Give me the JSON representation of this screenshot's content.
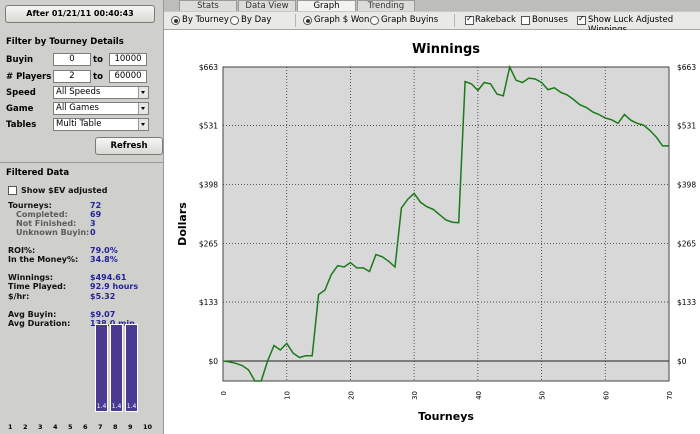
{
  "filter": {
    "date_button": "After 01/21/11 00:40:43",
    "title": "Filter by Tourney Details",
    "buyin_label": "Buyin",
    "buyin_min": "0",
    "buyin_max": "10000",
    "players_label": "# Players",
    "players_min": "2",
    "players_max": "60000",
    "to_label": "to",
    "speed_label": "Speed",
    "speed_value": "All Speeds",
    "game_label": "Game",
    "game_value": "All Games",
    "tables_label": "Tables",
    "tables_value": "Multi Table",
    "refresh_label": "Refresh"
  },
  "filtered": {
    "title": "Filtered Data",
    "sev_label": "Show $EV adjusted",
    "tourneys_label": "Tourneys:",
    "tourneys": "72",
    "completed_label": "Completed:",
    "completed": "69",
    "notfinished_label": "Not Finished:",
    "notfinished": "3",
    "unknown_label": "Unknown Buyin:",
    "unknown": "0",
    "roi_label": "ROI%:",
    "roi": "79.0%",
    "itm_label": "In the Money%:",
    "itm": "34.8%",
    "winnings_label": "Winnings:",
    "winnings": "$494.61",
    "time_label": "Time Played:",
    "time": "92.9  hours",
    "hr_label": "$/hr:",
    "hr": "$5.32",
    "avgbuyin_label": "Avg Buyin:",
    "avgbuyin": "$9.07",
    "avgdur_label": "Avg Duration:",
    "avgdur": "138.0  min"
  },
  "histogram": {
    "labels": [
      "1",
      "2",
      "3",
      "4",
      "5",
      "6",
      "7",
      "8",
      "9",
      "10"
    ],
    "values": [
      0,
      0,
      0,
      0,
      0,
      0,
      1.4,
      1.4,
      1.4,
      0
    ],
    "bar_color": "#4a3a92"
  },
  "tabs": [
    {
      "label": "Stats",
      "active": false
    },
    {
      "label": "Data View",
      "active": false
    },
    {
      "label": "Graph",
      "active": true
    },
    {
      "label": "Trending",
      "active": false
    }
  ],
  "options": {
    "by_tourney": "By Tourney",
    "by_day": "By Day",
    "graph_won": "Graph $ Won",
    "graph_buyins": "Graph Buyins",
    "rakeback": "Rakeback",
    "bonuses": "Bonuses",
    "luck": "Show Luck Adjusted Winnings"
  },
  "chart_data": {
    "type": "line",
    "title": "Winnings",
    "xlabel": "Tourneys",
    "ylabel": "Dollars",
    "xlim": [
      0,
      70
    ],
    "ylim": [
      -45,
      663
    ],
    "xticks": [
      0,
      10,
      20,
      30,
      40,
      50,
      60,
      70
    ],
    "yticks": [
      0,
      133,
      265,
      398,
      531,
      663
    ],
    "ytick_labels": [
      "$0",
      "$133",
      "$265",
      "$398",
      "$531",
      "$663"
    ],
    "grid": true,
    "line_color": "#1a7a1a",
    "series": [
      {
        "x": [
          0,
          1,
          2,
          3,
          4,
          5,
          6,
          7,
          8,
          9,
          10,
          11,
          12,
          13,
          14,
          15,
          16,
          17,
          18,
          19,
          20,
          21,
          22,
          23,
          24,
          25,
          26,
          27,
          28,
          29,
          30,
          31,
          32,
          33,
          34,
          35,
          36,
          37,
          38,
          39,
          40,
          41,
          42,
          43,
          44,
          45,
          46,
          47,
          48,
          49,
          50,
          51,
          52,
          53,
          54,
          55,
          56,
          57,
          58,
          59,
          60,
          61,
          62,
          63,
          64,
          65,
          66,
          67,
          68,
          69,
          70
        ],
        "y": [
          0,
          -2,
          -5,
          -10,
          -20,
          -45,
          -45,
          0,
          35,
          25,
          40,
          18,
          8,
          12,
          12,
          150,
          160,
          195,
          215,
          212,
          222,
          210,
          210,
          202,
          240,
          235,
          225,
          212,
          345,
          365,
          378,
          358,
          348,
          342,
          330,
          318,
          313,
          312,
          630,
          625,
          610,
          628,
          625,
          602,
          598,
          663,
          633,
          628,
          638,
          636,
          628,
          612,
          616,
          606,
          600,
          590,
          578,
          572,
          562,
          556,
          548,
          544,
          536,
          556,
          543,
          536,
          532,
          520,
          505,
          485,
          485
        ]
      }
    ]
  }
}
